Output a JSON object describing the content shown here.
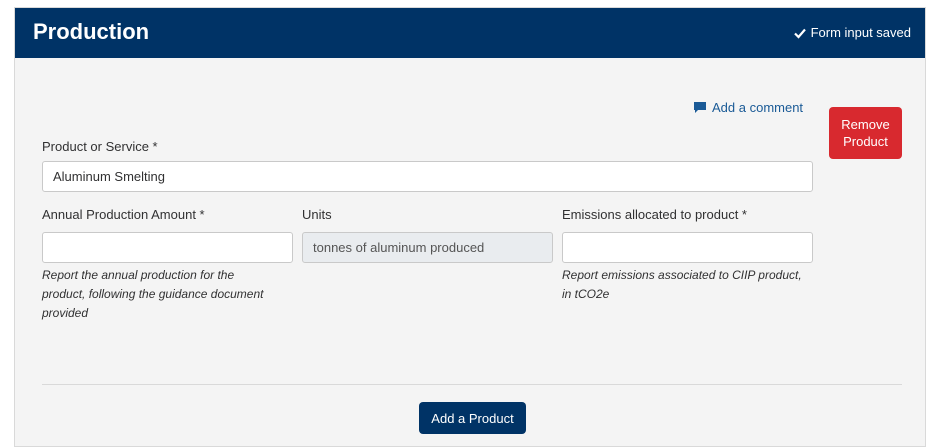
{
  "header": {
    "title": "Production",
    "saved_status": "Form input saved",
    "background_color": "#003366"
  },
  "comment_link": {
    "label": "Add a comment",
    "icon": "comment-icon"
  },
  "remove_button": {
    "line1": "Remove",
    "line2": "Product",
    "color": "#d8292f"
  },
  "product_field": {
    "label": "Product or Service *",
    "value": "Aluminum Smelting"
  },
  "production_amount": {
    "label": "Annual Production Amount *",
    "value": "",
    "help_line1": "Report the annual production for the",
    "help_line2": "product, following the guidance document",
    "help_line3": "provided"
  },
  "units": {
    "label": "Units",
    "value": "tonnes of aluminum produced"
  },
  "emissions": {
    "label": "Emissions allocated to product *",
    "value": "",
    "help_line1": "Report emissions associated to CIIP product,",
    "help_line2": "in tCO2e"
  },
  "add_product_button": {
    "label": "Add a Product"
  }
}
